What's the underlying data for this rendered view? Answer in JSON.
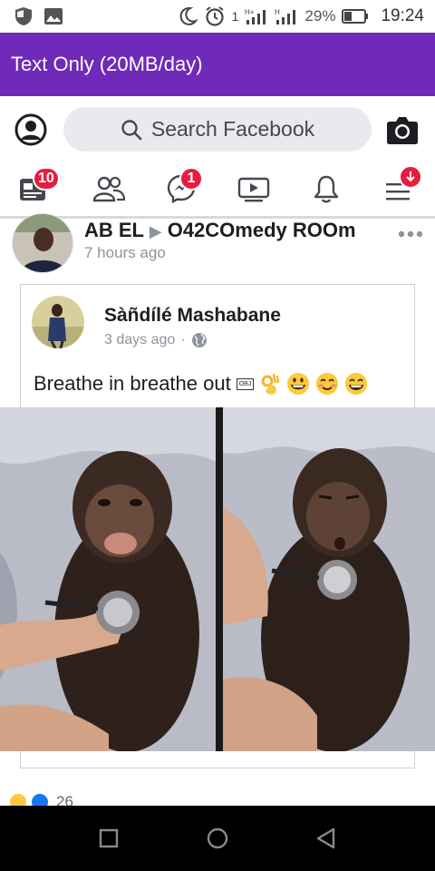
{
  "status_bar": {
    "battery": "29%",
    "time": "19:24",
    "net1": "1",
    "net2": "H+",
    "net3": "H"
  },
  "banner": {
    "title": "Text Only (20MB/day)"
  },
  "search": {
    "placeholder": "Search Facebook"
  },
  "tabs": {
    "home_badge": "10",
    "messenger_badge": "1"
  },
  "post": {
    "author": "AB EL",
    "author_arrow": "▶",
    "target": "O42COmedy ROOm",
    "time": "7 hours ago"
  },
  "shared": {
    "author": "Sàñdílé Mashabane",
    "time": "3 days ago",
    "separator": "·",
    "text": "Breathe in breathe out",
    "obj": "OBJ"
  },
  "reactions": {
    "count": "26"
  },
  "colors": {
    "banner": "#6f2ab9",
    "badge": "#e41e3f",
    "search_bg": "#e9eaee",
    "icon": "#444950"
  }
}
